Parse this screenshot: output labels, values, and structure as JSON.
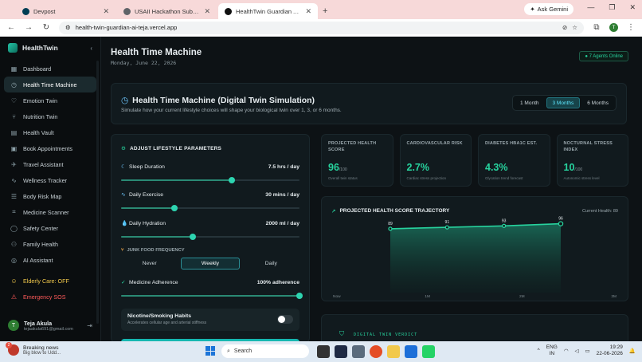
{
  "browser": {
    "tabs": [
      {
        "title": "Devpost",
        "color": "#003e54"
      },
      {
        "title": "USAII Hackathon Submission G",
        "color": "#5f6368"
      },
      {
        "title": "HealthTwin Guardian AI — Your",
        "color": "#111111"
      }
    ],
    "new_tab": "+",
    "gemini": "Ask Gemini",
    "url": "health-twin-guardian-ai-teja.vercel.app",
    "profile_initial": "T"
  },
  "sidebar": {
    "brand": "HealthTwin",
    "collapse": "‹",
    "items": [
      {
        "label": "Dashboard",
        "icon": "▦",
        "name": "dashboard"
      },
      {
        "label": "Health Time Machine",
        "icon": "◷",
        "name": "health-time-machine",
        "active": true
      },
      {
        "label": "Emotion Twin",
        "icon": "♡",
        "name": "emotion-twin"
      },
      {
        "label": "Nutrition Twin",
        "icon": "⑂",
        "name": "nutrition-twin"
      },
      {
        "label": "Health Vault",
        "icon": "▤",
        "name": "health-vault"
      },
      {
        "label": "Book Appointments",
        "icon": "▣",
        "name": "book-appointments"
      },
      {
        "label": "Travel Assistant",
        "icon": "✈",
        "name": "travel-assistant"
      },
      {
        "label": "Wellness Tracker",
        "icon": "∿",
        "name": "wellness-tracker"
      },
      {
        "label": "Body Risk Map",
        "icon": "☰",
        "name": "body-risk-map"
      },
      {
        "label": "Medicine Scanner",
        "icon": "⌗",
        "name": "medicine-scanner"
      },
      {
        "label": "Safety Center",
        "icon": "◯",
        "name": "safety-center"
      },
      {
        "label": "Family Health",
        "icon": "⚇",
        "name": "family-health"
      },
      {
        "label": "AI Assistant",
        "icon": "◎",
        "name": "ai-assistant"
      }
    ],
    "elderly": "Elderly Care: OFF",
    "sos": "Emergency SOS",
    "user": {
      "initial": "T",
      "name": "Teja Akula",
      "email": "tejaakula691@gmail.com"
    }
  },
  "header": {
    "title": "Health Time Machine",
    "date": "Monday, June 22, 2026",
    "agents": "● 7 Agents Online"
  },
  "hero": {
    "title": "Health Time Machine (Digital Twin Simulation)",
    "subtitle": "Simulate how your current lifestyle choices will shape your biological twin over 1, 3, or 6 months.",
    "options": [
      "1 Month",
      "3 Months",
      "6 Months"
    ],
    "selected": 1
  },
  "lifestyle": {
    "heading": "ADJUST LIFESTYLE PARAMETERS",
    "sleep": {
      "label": "Sleep Duration",
      "value": "7.5 hrs / day",
      "level": 0.62
    },
    "exercise": {
      "label": "Daily Exercise",
      "value": "30 mins / day",
      "level": 0.3
    },
    "hydration": {
      "label": "Daily Hydration",
      "value": "2000 ml / day",
      "level": 0.4
    },
    "junk_label": "JUNK FOOD FREQUENCY",
    "junk_options": [
      "Never",
      "Weekly",
      "Daily"
    ],
    "junk_selected": 1,
    "medicine": {
      "label": "Medicine Adherence",
      "value": "100% adherence",
      "level": 1.0
    },
    "nicotine": {
      "title": "Nicotine/Smoking Habits",
      "subtitle": "Accelerates cellular age and arterial stiffness"
    }
  },
  "metrics": [
    {
      "label": "PROJECTED HEALTH SCORE",
      "value": "96",
      "suffix": "/100",
      "sub": "Overall twin status"
    },
    {
      "label": "CARDIOVASCULAR RISK",
      "value": "2.7%",
      "suffix": "",
      "sub": "Cardiac stress projection"
    },
    {
      "label": "DIABETES HBA1C EST.",
      "value": "4.3%",
      "suffix": "",
      "sub": "Glycation trend forecast"
    },
    {
      "label": "NOCTURNAL STRESS INDEX",
      "value": "10",
      "suffix": "/100",
      "sub": "Autonomic stress level"
    }
  ],
  "trajectory": {
    "heading": "PROJECTED HEALTH SCORE TRAJECTORY",
    "current": "Current Health: 89"
  },
  "chart_data": {
    "type": "area",
    "title": "PROJECTED HEALTH SCORE TRAJECTORY",
    "x": [
      "Now",
      "1M",
      "2M",
      "3M"
    ],
    "series": [
      {
        "values": [
          89,
          91,
          93,
          96
        ]
      }
    ],
    "data_labels": [
      "89",
      "91",
      "93",
      "96"
    ],
    "ylim": [
      0,
      100
    ],
    "grid": false,
    "color": "#27d39e"
  },
  "verdict": {
    "heading": "DIGITAL TWIN VERDICT"
  },
  "taskbar": {
    "news_badge": "2",
    "news_title": "Breaking news",
    "news_sub": "Big blow to Udd...",
    "search": "Search",
    "lang1": "ENG",
    "lang2": "IN",
    "time": "19:29",
    "date": "22-06-2026"
  }
}
